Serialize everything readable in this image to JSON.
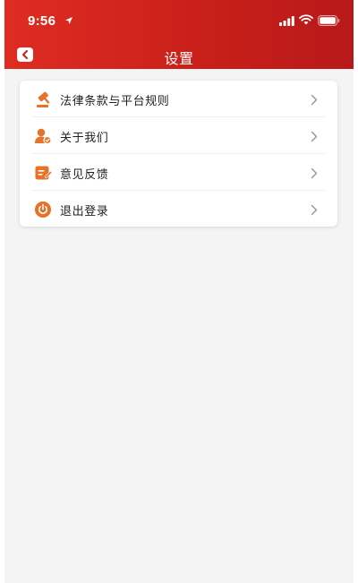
{
  "status_bar": {
    "time": "9:56"
  },
  "header": {
    "title": "设置"
  },
  "menu": {
    "items": [
      {
        "label": "法律条款与平台规则",
        "icon": "gavel-icon"
      },
      {
        "label": "关于我们",
        "icon": "user-check-icon"
      },
      {
        "label": "意见反馈",
        "icon": "feedback-edit-icon"
      },
      {
        "label": "退出登录",
        "icon": "power-icon"
      }
    ]
  },
  "colors": {
    "header_red": "#d0231c",
    "icon_orange": "#e5732a",
    "page_bg": "#f4f4f4"
  }
}
